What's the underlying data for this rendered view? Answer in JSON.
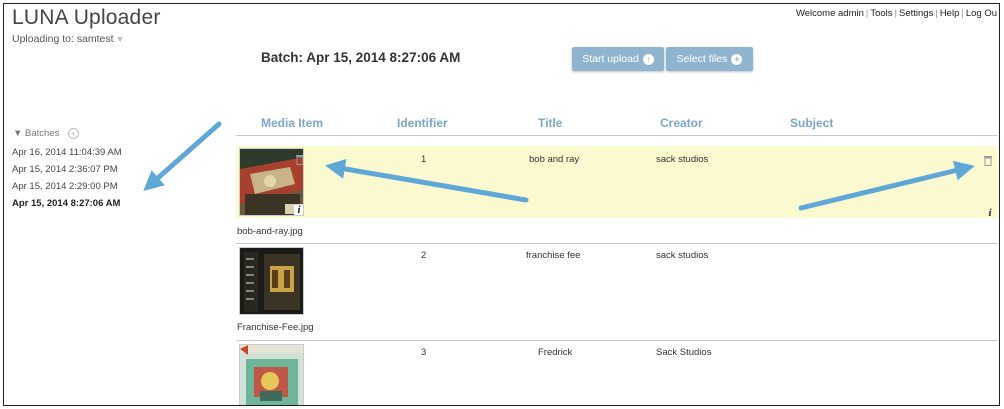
{
  "app": {
    "title": "LUNA Uploader",
    "uploading_to": "Uploading to: samtest"
  },
  "topnav": {
    "welcome": "Welcome admin",
    "tools": "Tools",
    "settings": "Settings",
    "help": "Help",
    "logout": "Log Ou"
  },
  "batch": {
    "title": "Batch: Apr 15, 2014 8:27:06 AM"
  },
  "actions": {
    "start_upload": "Start upload",
    "select_files": "Select files"
  },
  "sidebar": {
    "heading": "Batches",
    "items": [
      {
        "label": "Apr 16, 2014 11:04:39 AM",
        "active": false
      },
      {
        "label": "Apr 15, 2014 2:36:07 PM",
        "active": false
      },
      {
        "label": "Apr 15, 2014 2:29:00 PM",
        "active": false
      },
      {
        "label": "Apr 15, 2014 8:27:06 AM",
        "active": true
      }
    ]
  },
  "table": {
    "columns": [
      "Media Item",
      "Identifier",
      "Title",
      "Creator",
      "Subject"
    ],
    "rows": [
      {
        "filename": "bob-and-ray.jpg",
        "identifier": "1",
        "title": "bob and ray",
        "creator": "sack studios",
        "subject": "",
        "selected": true
      },
      {
        "filename": "Franchise-Fee.jpg",
        "identifier": "2",
        "title": "franchise fee",
        "creator": "sack studios",
        "subject": "",
        "selected": false
      },
      {
        "filename": "",
        "identifier": "3",
        "title": "Fredrick",
        "creator": "Sack Studios",
        "subject": "",
        "selected": false
      }
    ]
  },
  "colors": {
    "accent": "#7aa6c8",
    "button": "#8fb4cf",
    "highlight_row": "#fbf9cf",
    "annotation_arrow": "#5ea7d6"
  },
  "icons": {
    "trash": "trash-icon",
    "info": "info-icon",
    "add": "plus-circle-icon",
    "upload": "upload-arrow-icon",
    "collapse": "triangle-down-icon"
  }
}
